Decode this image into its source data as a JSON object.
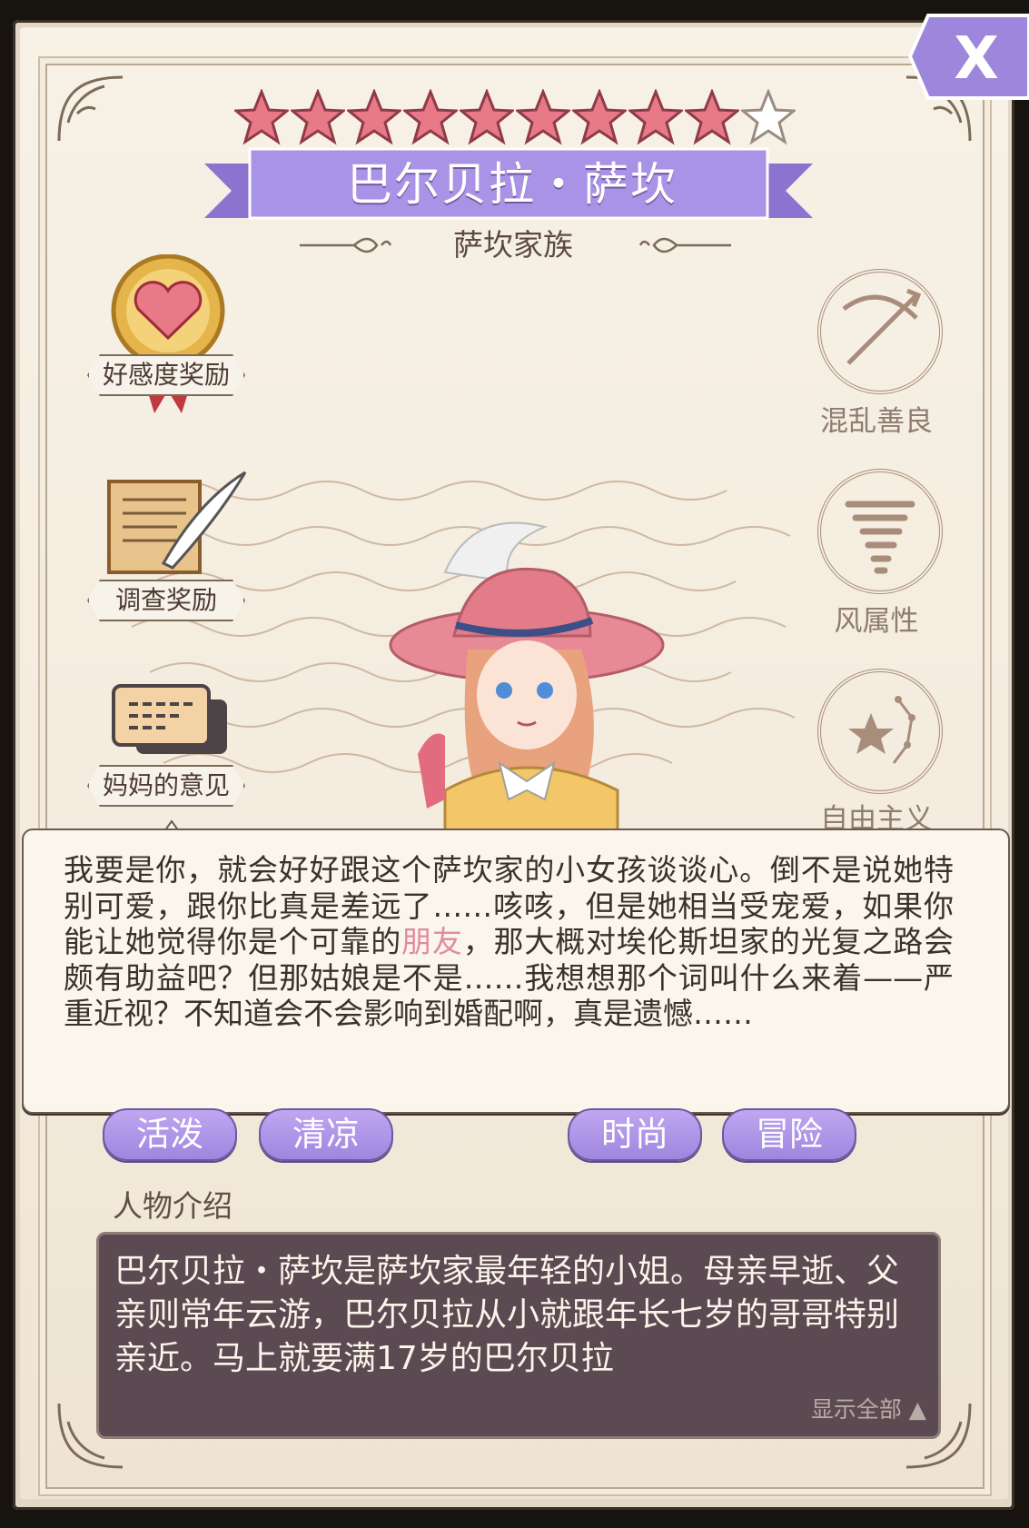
{
  "header": {
    "stars_filled": 9,
    "stars_total": 10,
    "character_name": "巴尔贝拉・萨坎",
    "family": "萨坎家族"
  },
  "close_button": {
    "label": "X"
  },
  "left_menu": {
    "affection_reward": "好感度奖励",
    "investigation_reward": "调查奖励",
    "mom_opinion": "妈妈的意见"
  },
  "traits": {
    "alignment": "混乱善良",
    "element": "风属性",
    "ideology": "自由主义"
  },
  "tooltip": {
    "text_before": "我要是你，就会好好跟这个萨坎家的小女孩谈谈心。倒不是说她特别可爱，跟你比真是差远了……咳咳，但是她相当受宠爱，如果你能让她觉得你是个可靠的",
    "highlight": "朋友",
    "text_after": "，那大概对埃伦斯坦家的光复之路会颇有助益吧？但那姑娘是不是……我想想那个词叫什么来着——严重近视？不知道会不会影响到婚配啊，真是遗憾……"
  },
  "tags": [
    "活泼",
    "清凉",
    "时尚",
    "冒险"
  ],
  "intro": {
    "label": "人物介绍",
    "text": "巴尔贝拉・萨坎是萨坎家最年轻的小姐。母亲早逝、父亲则常年云游，巴尔贝拉从小就跟年长七岁的哥哥特别亲近。马上就要满17岁的巴尔贝拉",
    "show_all": "显示全部 ▲"
  },
  "colors": {
    "star": "#e77a86",
    "ribbon": "#a993e6",
    "tag": "#b39ced",
    "intro_bg": "#5c4a52",
    "highlight": "#e38a9d"
  }
}
